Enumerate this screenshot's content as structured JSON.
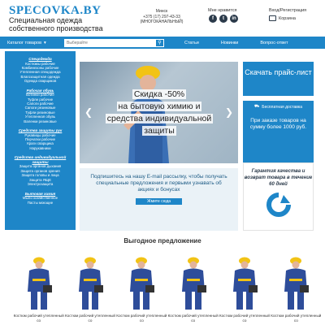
{
  "header": {
    "logo": "SPECOVKA.BY",
    "tagline": "Специальная одежда собственного производства",
    "contact": {
      "city": "Минск",
      "phone": "+375 (17) 297-43-33",
      "phone_note": "(МНОГОКАНАЛЬНЫЙ)"
    },
    "social_label": "Мне нравится",
    "login": "Вход/Регистрация",
    "cart": "Корзина"
  },
  "nav": {
    "catalog": "Каталог товаров",
    "search_placeholder": "Выберайте",
    "links": [
      "Статьи",
      "Новинки",
      "Вопрос-ответ"
    ]
  },
  "sidebar": [
    {
      "category": "Спецодежда",
      "items": [
        "Костюмы рабочие",
        "Комбинезоны рабочие",
        "Утепленная спецодежда",
        "Влагозащитная одежда",
        "Одежда сварщиков"
      ]
    },
    {
      "category": "Рабочая обувь",
      "items": [
        "Ботинки рабочие",
        "Туфли рабочие",
        "Сапоги рабочие",
        "Сапоги резиновые",
        "Туфли резиновые",
        "Утепленная обувь",
        "Валенки резиновые"
      ]
    },
    {
      "category": "Средства защиты рук",
      "items": [
        "Рукавицы рабочие",
        "Перчатки рабочие",
        "Краги сварщика",
        "Нарукавники"
      ]
    },
    {
      "category": "Средства индивидуальной защиты",
      "items": [
        "Защита органов дыхания",
        "Защита органов зрения",
        "Защита головы и лица",
        "Защита ЯЩЕ",
        "Электрозащита"
      ]
    },
    {
      "category": "Бытовая химия",
      "items": [
        "Мыло хозяйственное",
        "Пасты моющие"
      ]
    }
  ],
  "slider": {
    "text": [
      "Скидка -50%",
      "на бытовую химию и",
      "средства индивидуальной",
      "защиты"
    ]
  },
  "price_button": "Скачать прайс-лист",
  "delivery": {
    "title": "Бесплатная доставка",
    "text": "При заказе товаров на сумму более 1000 руб."
  },
  "returns": {
    "text": "Гарантия качества и возврат товара в течение 60 дней"
  },
  "newsletter": {
    "text": "Подпишитесь на нашу E-mail рассылку, чтобы получать специальные предложения и первыми узнавать об акциях и бонусах",
    "button": "Жмите сюда"
  },
  "offers": {
    "title": "Выгодное предложение",
    "products": [
      {
        "name": "Костюм рабочий утепленный со"
      },
      {
        "name": "Костюм рабочий утепленный со"
      },
      {
        "name": "Костюм рабочий утепленный со"
      },
      {
        "name": "Костюм рабочий утепленный со"
      },
      {
        "name": "Костюм рабочий утепленный со"
      },
      {
        "name": "Костюм рабочий утепленный со"
      }
    ]
  },
  "colors": {
    "brand_blue": "#1e86c8",
    "dark": "#2b3a4a",
    "light_bg": "#eaf2f7"
  }
}
